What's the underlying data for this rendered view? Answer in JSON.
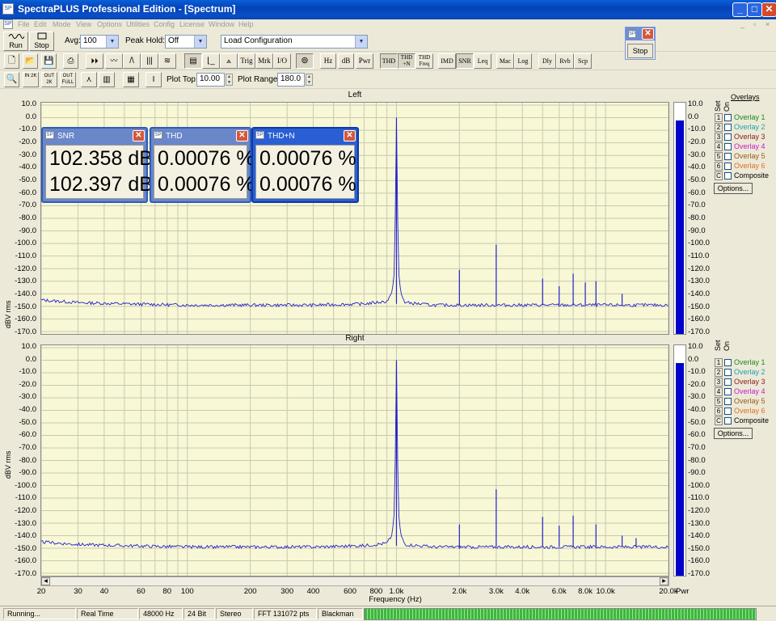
{
  "window": {
    "title": "SpectraPLUS Professional Edition - [Spectrum]",
    "minimize": "_",
    "restore": "□",
    "close": "✕"
  },
  "menu": [
    "File",
    "Edit",
    "Mode",
    "View",
    "Options",
    "Utilities",
    "Config",
    "License",
    "Window",
    "Help"
  ],
  "toolbar1": {
    "run": "Run",
    "stop": "Stop",
    "avg_label": "Avg:",
    "avg_value": "100",
    "peak_label": "Peak Hold:",
    "peak_value": "Off",
    "config_value": "Load Configuration"
  },
  "toolbar2": [
    "Trig",
    "Mrk",
    "I/O",
    "Hz",
    "dB",
    "Pwr",
    "THD",
    "THD +N",
    "THD Freq",
    "IMD",
    "SNR",
    "Leq",
    "Mac",
    "Log",
    "Dly",
    "Rvb",
    "Scp"
  ],
  "toolbar3": {
    "io_labels": [
      "IN 2K",
      "OUT 2K",
      "OUT FULL"
    ],
    "plot_top_label": "Plot Top:",
    "plot_top_value": "10.00",
    "plot_range_label": "Plot Range:",
    "plot_range_value": "180.0"
  },
  "stop_window": {
    "button": "Stop"
  },
  "meters": [
    {
      "title": "SNR",
      "values": [
        "102.358 dB",
        "102.397 dB"
      ]
    },
    {
      "title": "THD",
      "values": [
        "0.00076 %",
        "0.00076 %"
      ]
    },
    {
      "title": "THD+N",
      "values": [
        "0.00076 %",
        "0.00076 %"
      ]
    }
  ],
  "panes": [
    {
      "title": "Left"
    },
    {
      "title": "Right"
    }
  ],
  "y_axis": {
    "title": "dBV rms",
    "ticks": [
      "10.0",
      "0.0",
      "-10.0",
      "-20.0",
      "-30.0",
      "-40.0",
      "-50.0",
      "-60.0",
      "-70.0",
      "-80.0",
      "-90.0",
      "-100.0",
      "-110.0",
      "-120.0",
      "-130.0",
      "-140.0",
      "-150.0",
      "-160.0",
      "-170.0"
    ]
  },
  "x_axis": {
    "title": "Frequency (Hz)",
    "ticks": [
      "20",
      "30",
      "40",
      "60",
      "80",
      "100",
      "200",
      "300",
      "400",
      "600",
      "800",
      "1.0k",
      "2.0k",
      "3.0k",
      "4.0k",
      "6.0k",
      "8.0k",
      "10.0k",
      "20.0k"
    ],
    "pwr": "Pwr"
  },
  "overlays": {
    "title": "Overlays",
    "set_label": "Set",
    "on_label": "On",
    "items": [
      {
        "n": "1",
        "label": "Overlay 1",
        "color": "#1a8a1a"
      },
      {
        "n": "2",
        "label": "Overlay 2",
        "color": "#1aa6a6"
      },
      {
        "n": "3",
        "label": "Overlay 3",
        "color": "#8a1a1a"
      },
      {
        "n": "4",
        "label": "Overlay 4",
        "color": "#c81ac8"
      },
      {
        "n": "5",
        "label": "Overlay 5",
        "color": "#9a5a1a"
      },
      {
        "n": "6",
        "label": "Overlay 6",
        "color": "#e07020"
      },
      {
        "n": "C",
        "label": "Composite",
        "color": "#000000"
      }
    ],
    "options": "Options..."
  },
  "chart_data": [
    {
      "type": "line",
      "title": "Left",
      "xlabel": "Frequency (Hz)",
      "ylabel": "dBV rms",
      "xscale": "log",
      "xlim": [
        20,
        20000
      ],
      "ylim": [
        -170,
        10
      ],
      "grid": true,
      "series": [
        {
          "color": "#2222cc",
          "x": [
            20,
            30,
            50,
            100,
            200,
            400,
            700,
            900,
            950,
            980,
            1000,
            1020,
            1050,
            1100,
            1500,
            2000,
            3000,
            4000,
            5000,
            6000,
            7000,
            8000,
            9000,
            10000,
            12000,
            15000,
            20000
          ],
          "y": [
            -145,
            -147,
            -148,
            -149,
            -149,
            -149,
            -148,
            -146,
            -140,
            -120,
            0,
            -120,
            -140,
            -147,
            -149,
            -149,
            -149,
            -149,
            -149,
            -149,
            -149,
            -149,
            -149,
            -149,
            -149,
            -149,
            -149
          ]
        }
      ],
      "harmonics": {
        "x": [
          2000,
          3000,
          5000,
          6000,
          7000,
          8000,
          9000,
          12000
        ],
        "y": [
          -121,
          -101,
          -128,
          -134,
          -124,
          -131,
          -130,
          -140
        ]
      }
    },
    {
      "type": "line",
      "title": "Right",
      "xlabel": "Frequency (Hz)",
      "ylabel": "dBV rms",
      "xscale": "log",
      "xlim": [
        20,
        20000
      ],
      "ylim": [
        -170,
        10
      ],
      "grid": true,
      "series": [
        {
          "color": "#2222cc",
          "x": [
            20,
            30,
            50,
            100,
            200,
            400,
            700,
            900,
            950,
            980,
            1000,
            1020,
            1050,
            1100,
            1500,
            2000,
            3000,
            4000,
            5000,
            6000,
            7000,
            8000,
            9000,
            10000,
            12000,
            15000,
            20000
          ],
          "y": [
            -145,
            -147,
            -148,
            -149,
            -149,
            -149,
            -148,
            -146,
            -140,
            -120,
            0,
            -120,
            -140,
            -147,
            -149,
            -149,
            -149,
            -149,
            -149,
            -149,
            -149,
            -149,
            -149,
            -149,
            -149,
            -149,
            -149
          ]
        }
      ],
      "harmonics": {
        "x": [
          2000,
          3000,
          5000,
          6000,
          7000,
          9000,
          12000,
          14000
        ],
        "y": [
          -131,
          -103,
          -125,
          -132,
          -124,
          -131,
          -140,
          -142
        ]
      }
    }
  ],
  "level_bars": {
    "left_db": 0,
    "right_db": 0
  },
  "status": [
    "Running...",
    "Real Time",
    "48000 Hz",
    "24 Bit",
    "Stereo",
    "FFT 131072 pts",
    "Blackman"
  ]
}
